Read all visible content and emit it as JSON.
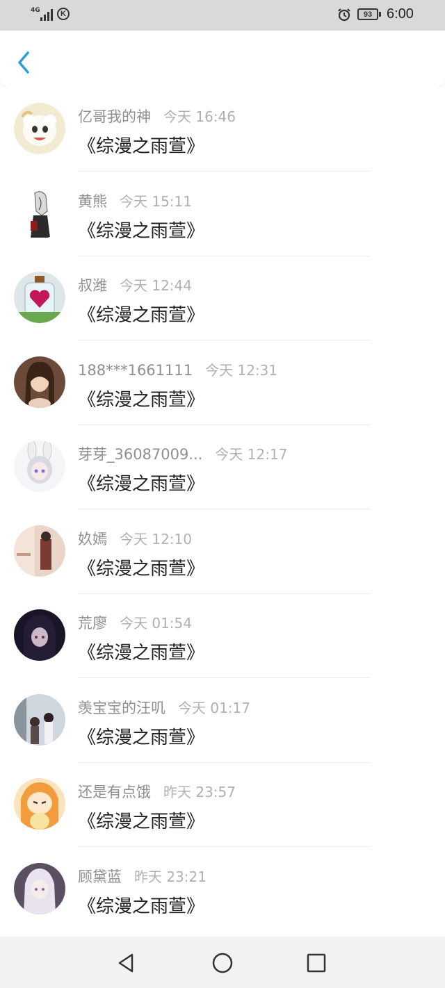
{
  "status_bar": {
    "network": "4G",
    "battery": "93",
    "time": "6:00"
  },
  "conversations": [
    {
      "name": "亿哥我的神",
      "time": "今天 16:46",
      "message": "《综漫之雨萱》",
      "avatar": "sheep-avatar"
    },
    {
      "name": "黄熊",
      "time": "今天 15:11",
      "message": "《综漫之雨萱》",
      "avatar": "anime-girl-sketch-avatar"
    },
    {
      "name": "叔潍",
      "time": "今天 12:44",
      "message": "《综漫之雨萱》",
      "avatar": "heart-jar-avatar"
    },
    {
      "name": "188***1661111",
      "time": "今天 12:31",
      "message": "《综漫之雨萱》",
      "avatar": "portrait-avatar"
    },
    {
      "name": "芽芽_36087009...",
      "time": "今天 12:17",
      "message": "《综漫之雨萱》",
      "avatar": "bunny-girl-avatar"
    },
    {
      "name": "奺嫣",
      "time": "今天 12:10",
      "message": "《综漫之雨萱》",
      "avatar": "street-scene-avatar"
    },
    {
      "name": "荒廖",
      "time": "今天 01:54",
      "message": "《综漫之雨萱》",
      "avatar": "dark-anime-avatar"
    },
    {
      "name": "羡宝宝的汪叽",
      "time": "今天 01:17",
      "message": "《综漫之雨萱》",
      "avatar": "couple-avatar"
    },
    {
      "name": "还是有点饿",
      "time": "昨天 23:57",
      "message": "《综漫之雨萱》",
      "avatar": "umaru-avatar"
    },
    {
      "name": "顾黛蓝",
      "time": "昨天 23:21",
      "message": "《综漫之雨萱》",
      "avatar": "white-hair-girl-avatar"
    }
  ],
  "colors": {
    "accent": "#2a9fd6",
    "name_text": "#8f8f8f",
    "time_text": "#b0b0b0",
    "message_text": "#1f1f1f"
  }
}
